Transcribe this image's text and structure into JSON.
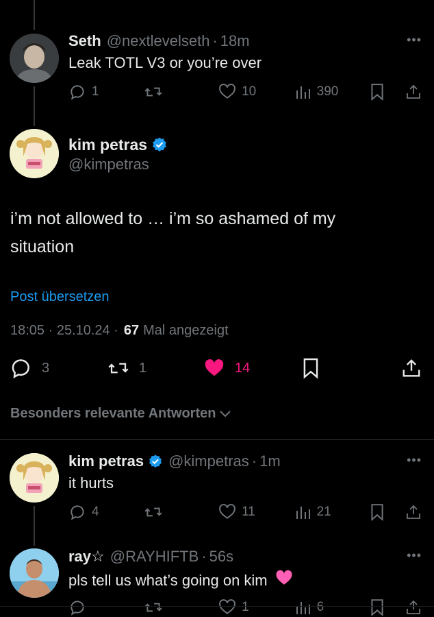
{
  "reply_seth": {
    "name": "Seth",
    "handle": "@nextlevelseth",
    "sep": "·",
    "time": "18m",
    "text": "Leak TOTL V3 or you’re over",
    "replies": "1",
    "likes": "10",
    "views": "390"
  },
  "main_post": {
    "name": "kim petras",
    "handle": "@kimpetras",
    "text_line1": "i’m not allowed to … i’m so ashamed of my",
    "text_line2": "situation",
    "translate": "Post übersetzen",
    "timestamp": "18:05 · 25.10.24 ·",
    "view_count": "67",
    "view_label": "Mal angezeigt",
    "replies": "3",
    "reposts": "1",
    "likes": "14",
    "liked_color": "#f91880"
  },
  "sort": {
    "label": "Besonders relevante Antworten"
  },
  "reply_kim": {
    "name": "kim petras",
    "handle": "@kimpetras",
    "sep": "·",
    "time": "1m",
    "text": "it hurts",
    "replies": "4",
    "likes": "11",
    "views": "21"
  },
  "reply_ray": {
    "name": "ray☆",
    "handle": "@RAYHIFTB",
    "sep": "·",
    "time": "56s",
    "text": "pls tell us what’s going on kim",
    "emoji": "🩷",
    "likes": "1",
    "views": "6"
  },
  "colors": {
    "background": "#000000",
    "text": "#e7e9ea",
    "muted": "#71767b",
    "link": "#1d9bf0",
    "verified": "#1d9bf0"
  }
}
